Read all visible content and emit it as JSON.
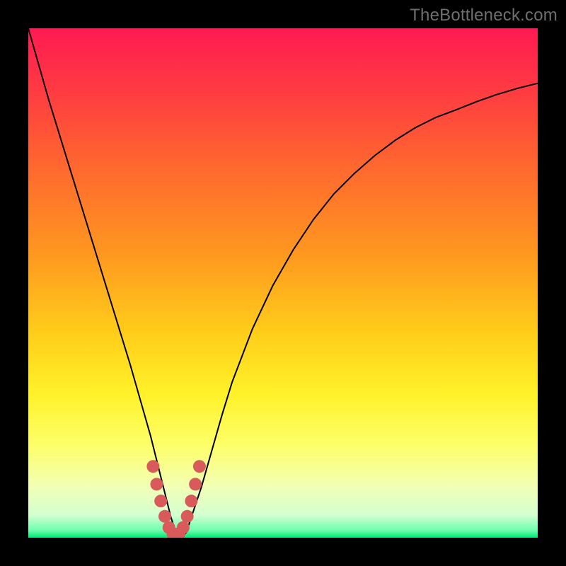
{
  "watermark": "TheBottleneck.com",
  "chart_data": {
    "type": "line",
    "title": "",
    "xlabel": "",
    "ylabel": "",
    "xlim": [
      0,
      100
    ],
    "ylim": [
      0,
      100
    ],
    "background_gradient": {
      "stops": [
        {
          "offset": 0.0,
          "color": "#ff1a53"
        },
        {
          "offset": 0.12,
          "color": "#ff3a42"
        },
        {
          "offset": 0.28,
          "color": "#ff6a2e"
        },
        {
          "offset": 0.45,
          "color": "#ff9a1f"
        },
        {
          "offset": 0.6,
          "color": "#ffce1a"
        },
        {
          "offset": 0.72,
          "color": "#fff22a"
        },
        {
          "offset": 0.82,
          "color": "#fdff6a"
        },
        {
          "offset": 0.9,
          "color": "#f2ffb5"
        },
        {
          "offset": 0.955,
          "color": "#d4ffd1"
        },
        {
          "offset": 0.985,
          "color": "#6fffb0"
        },
        {
          "offset": 1.0,
          "color": "#00e874"
        }
      ]
    },
    "series": [
      {
        "name": "curve",
        "stroke": "#000000",
        "stroke_width": 2,
        "x": [
          0,
          2,
          4,
          6,
          8,
          10,
          12,
          14,
          16,
          18,
          20,
          22,
          24,
          25,
          26,
          27,
          28,
          29,
          30,
          31,
          32,
          34,
          36,
          38,
          40,
          44,
          48,
          52,
          56,
          60,
          64,
          68,
          72,
          76,
          80,
          84,
          88,
          92,
          96,
          100
        ],
        "y": [
          100,
          93,
          86,
          79.5,
          73,
          66.5,
          60,
          53.5,
          47,
          40.5,
          34,
          27,
          20,
          16,
          12,
          8,
          4,
          1,
          0,
          1,
          4,
          10,
          17,
          24,
          30.5,
          41,
          49.5,
          56.5,
          62.5,
          67.5,
          71.5,
          75,
          78,
          80.5,
          82.5,
          84,
          85.6,
          87,
          88.2,
          89.2
        ]
      },
      {
        "name": "bottom-marker",
        "type": "marker-band",
        "stroke": "#d85a5a",
        "stroke_width": 9,
        "x": [
          24.5,
          25.2,
          26.0,
          26.8,
          27.6,
          28.4,
          29.0,
          29.6,
          30.4,
          31.2,
          32.0,
          32.8,
          33.6
        ],
        "y": [
          14.0,
          10.5,
          7.2,
          4.2,
          2.0,
          0.8,
          0.4,
          0.8,
          2.0,
          4.2,
          7.2,
          10.5,
          14.0
        ]
      }
    ]
  }
}
